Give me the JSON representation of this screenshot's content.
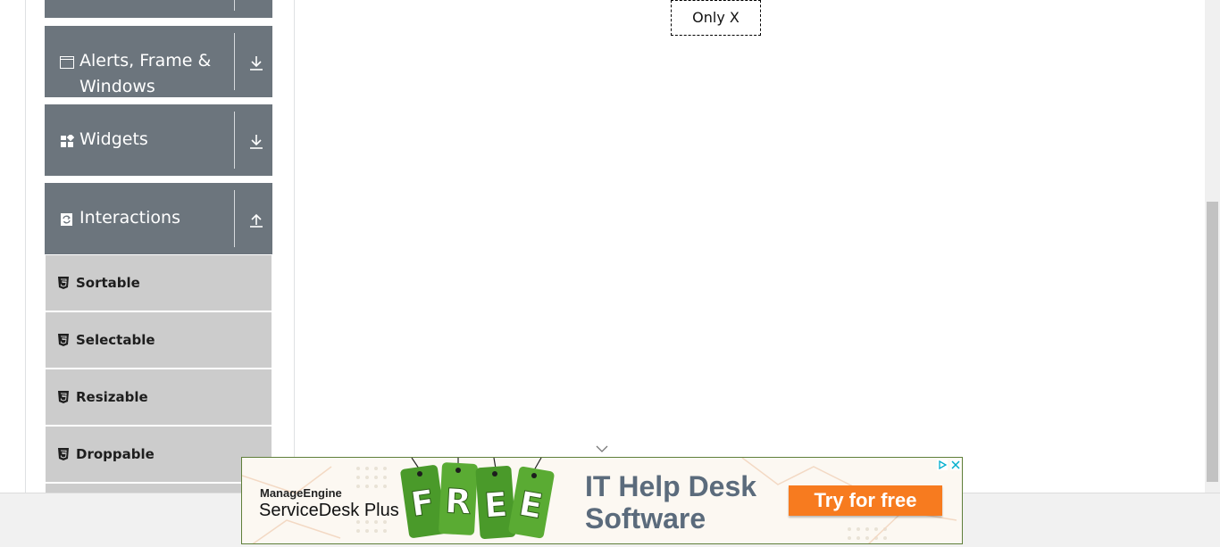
{
  "sidebar": {
    "groups": [
      {
        "title": "",
        "icon": "partial-group"
      },
      {
        "title": "Alerts, Frame &",
        "title2": "Windows",
        "icon": "window-icon",
        "toggle": "download-arrow-icon"
      },
      {
        "title": "Widgets",
        "icon": "widgets-icon",
        "toggle": "download-arrow-icon"
      },
      {
        "title": "Interactions",
        "icon": "interactions-icon",
        "toggle": "upload-arrow-icon"
      }
    ],
    "items": [
      {
        "label": "Sortable"
      },
      {
        "label": "Selectable"
      },
      {
        "label": "Resizable"
      },
      {
        "label": "Droppable"
      }
    ]
  },
  "main": {
    "drag_box_label": "Only X"
  },
  "ad": {
    "brand_line1": "ManageEngine",
    "brand_line2": "ServiceDesk Plus",
    "tag_letters": [
      "F",
      "R",
      "E",
      "E"
    ],
    "headline1": "IT Help Desk",
    "headline2": "Software",
    "cta": "Try for free",
    "colors": {
      "cta": "#f77b1f",
      "tags": "#4a9a2a",
      "headline": "#5b6b7c"
    }
  },
  "colors": {
    "group_bg": "#6c757d",
    "item_bg": "#cccccc"
  }
}
